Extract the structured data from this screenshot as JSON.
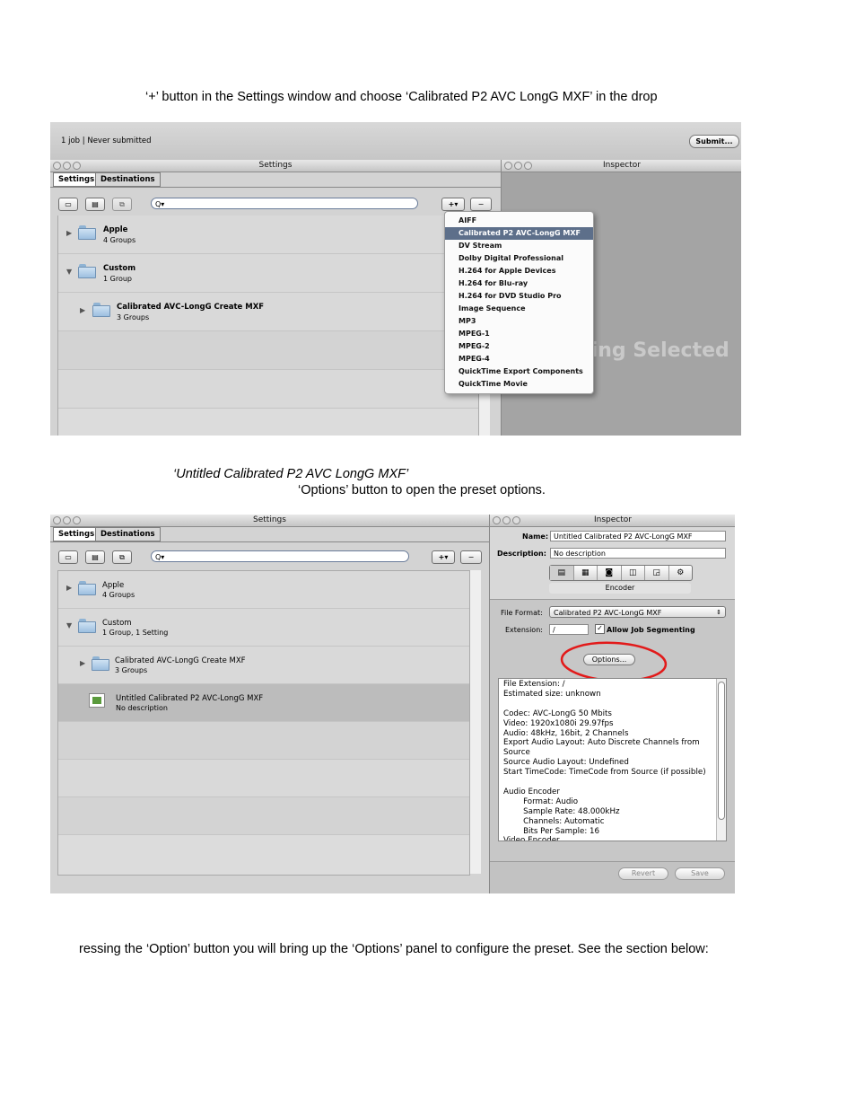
{
  "doc": {
    "line1": "‘+’ button in the Settings window and choose ‘Calibrated P2 AVC LongG MXF’ in the drop",
    "line2": "‘Untitled Calibrated P2 AVC LongG MXF’",
    "line3": "‘Options’ button to open the preset options.",
    "line4": "ressing the ‘Option’ button you will bring up the ‘Options’ panel to configure the preset. See the section below:"
  },
  "shot1": {
    "batch_status": "1 job   |   Never submitted",
    "submit_label": "Submit...",
    "settings_title": "Settings",
    "inspector_title": "Inspector",
    "tabs": [
      "Settings",
      "Destinations"
    ],
    "search_value": "Q▾",
    "plus_label": "+▾",
    "minus_label": "−",
    "rows": [
      {
        "title": "Apple",
        "sub": "4 Groups"
      },
      {
        "title": "Custom",
        "sub": "1 Group"
      },
      {
        "title": "Calibrated AVC-LongG Create MXF",
        "sub": "3 Groups"
      }
    ],
    "nothing_selected": "Nothing Selected",
    "menu_items": [
      "AIFF",
      "Calibrated P2 AVC-LongG MXF",
      "DV Stream",
      "Dolby Digital Professional",
      "H.264 for Apple Devices",
      "H.264 for Blu-ray",
      "H.264 for DVD Studio Pro",
      "Image Sequence",
      "MP3",
      "MPEG-1",
      "MPEG-2",
      "MPEG-4",
      "QuickTime Export Components",
      "QuickTime Movie"
    ],
    "menu_selected_index": 1
  },
  "shot2": {
    "settings_title": "Settings",
    "inspector_title": "Inspector",
    "tabs": [
      "Settings",
      "Destinations"
    ],
    "search_value": "Q▾",
    "plus_label": "+▾",
    "minus_label": "−",
    "rows": [
      {
        "title": "Apple",
        "sub": "4 Groups"
      },
      {
        "title": "Custom",
        "sub": "1 Group, 1 Setting"
      },
      {
        "title": "Calibrated AVC-LongG Create MXF",
        "sub": "3 Groups"
      },
      {
        "title": "Untitled Calibrated P2 AVC-LongG MXF",
        "sub": "No description"
      }
    ],
    "name_label": "Name:",
    "name_value": "Untitled Calibrated P2 AVC-LongG MXF",
    "description_label": "Description:",
    "description_value": "No description",
    "encoder_label": "Encoder",
    "file_format_label": "File Format:",
    "file_format_value": "Calibrated P2 AVC-LongG MXF",
    "extension_label": "Extension:",
    "extension_value": "/",
    "allow_job_segmenting": "Allow Job Segmenting",
    "options_label": "Options...",
    "summary": [
      "File Extension: /",
      "Estimated size: unknown",
      "",
      "Codec: AVC-LongG 50 Mbits",
      "Video: 1920x1080i 29.97fps",
      "Audio: 48kHz, 16bit, 2 Channels",
      "Export Audio Layout: Auto Discrete Channels from",
      "Source",
      "Source Audio Layout: Undefined",
      "Start TimeCode: TimeCode from Source (if possible)",
      "",
      "Audio Encoder",
      "        Format: Audio",
      "        Sample Rate: 48.000kHz",
      "        Channels: Automatic",
      "        Bits Per Sample: 16",
      "Video Encoder"
    ],
    "revert_label": "Revert",
    "save_label": "Save"
  }
}
